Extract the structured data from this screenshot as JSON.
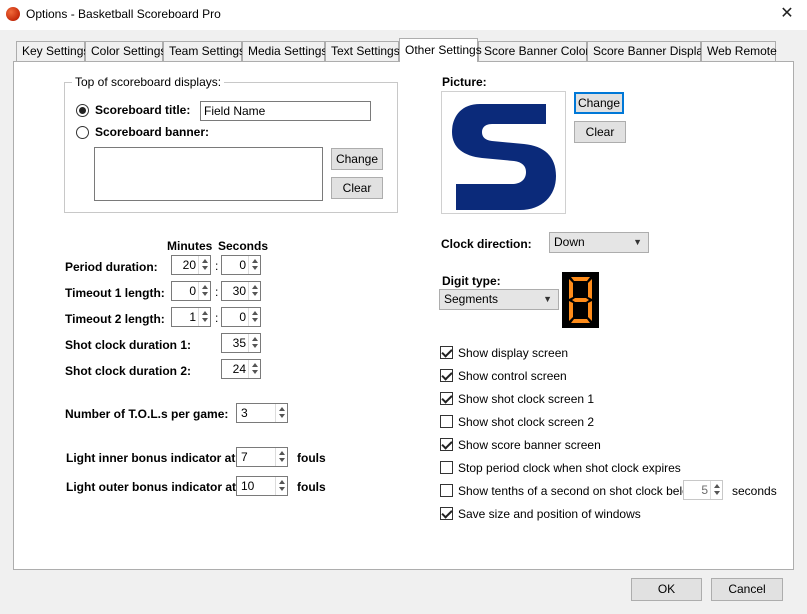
{
  "window": {
    "title": "Options - Basketball Scoreboard Pro",
    "close_glyph": "✕"
  },
  "tabs": [
    {
      "label": "Key Settings"
    },
    {
      "label": "Color Settings"
    },
    {
      "label": "Team Settings"
    },
    {
      "label": "Media Settings"
    },
    {
      "label": "Text Settings"
    },
    {
      "label": "Other Settings",
      "active": true
    },
    {
      "label": "Score Banner Colors"
    },
    {
      "label": "Score Banner Display"
    },
    {
      "label": "Web Remote"
    }
  ],
  "top_display": {
    "group_label": "Top of scoreboard displays:",
    "title_radio_label": "Scoreboard title:",
    "title_value": "Field Name",
    "banner_radio_label": "Scoreboard banner:",
    "change_label": "Change",
    "clear_label": "Clear"
  },
  "durations": {
    "minutes_header": "Minutes",
    "seconds_header": "Seconds",
    "period_label": "Period duration:",
    "period_minutes": "20",
    "period_seconds": "0",
    "timeout1_label": "Timeout  1 length:",
    "timeout1_minutes": "0",
    "timeout1_seconds": "30",
    "timeout2_label": "Timeout  2 length:",
    "timeout2_minutes": "1",
    "timeout2_seconds": "0",
    "colon": ":",
    "shot1_label": "Shot clock duration 1:",
    "shot1_value": "35",
    "shot2_label": "Shot clock duration 2:",
    "shot2_value": "24"
  },
  "tols": {
    "label": "Number of T.O.L.s per game:",
    "value": "3"
  },
  "bonus": {
    "inner_label": "Light inner bonus indicator at",
    "inner_value": "7",
    "outer_label": "Light outer bonus indicator at",
    "outer_value": "10",
    "fouls_label": "fouls"
  },
  "picture": {
    "label": "Picture:",
    "change_label": "Change",
    "clear_label": "Clear",
    "logo_color": "#0b2a7a"
  },
  "clock_direction": {
    "label": "Clock direction:",
    "value": "Down"
  },
  "digit_type": {
    "label": "Digit type:",
    "value": "Segments",
    "preview_color": "#ff8c1a"
  },
  "checkboxes": [
    {
      "label": "Show display screen",
      "checked": true
    },
    {
      "label": "Show control screen",
      "checked": true
    },
    {
      "label": "Show shot clock screen 1",
      "checked": true
    },
    {
      "label": "Show shot clock screen 2",
      "checked": false
    },
    {
      "label": "Show score banner screen",
      "checked": true
    },
    {
      "label": "Stop period clock when shot clock expires",
      "checked": false
    },
    {
      "label": "Show tenths of a second on shot clock below",
      "checked": false
    },
    {
      "label": "Save size and position of windows",
      "checked": true
    }
  ],
  "tenths": {
    "value": "5",
    "unit_label": "seconds"
  },
  "footer": {
    "ok_label": "OK",
    "cancel_label": "Cancel"
  }
}
